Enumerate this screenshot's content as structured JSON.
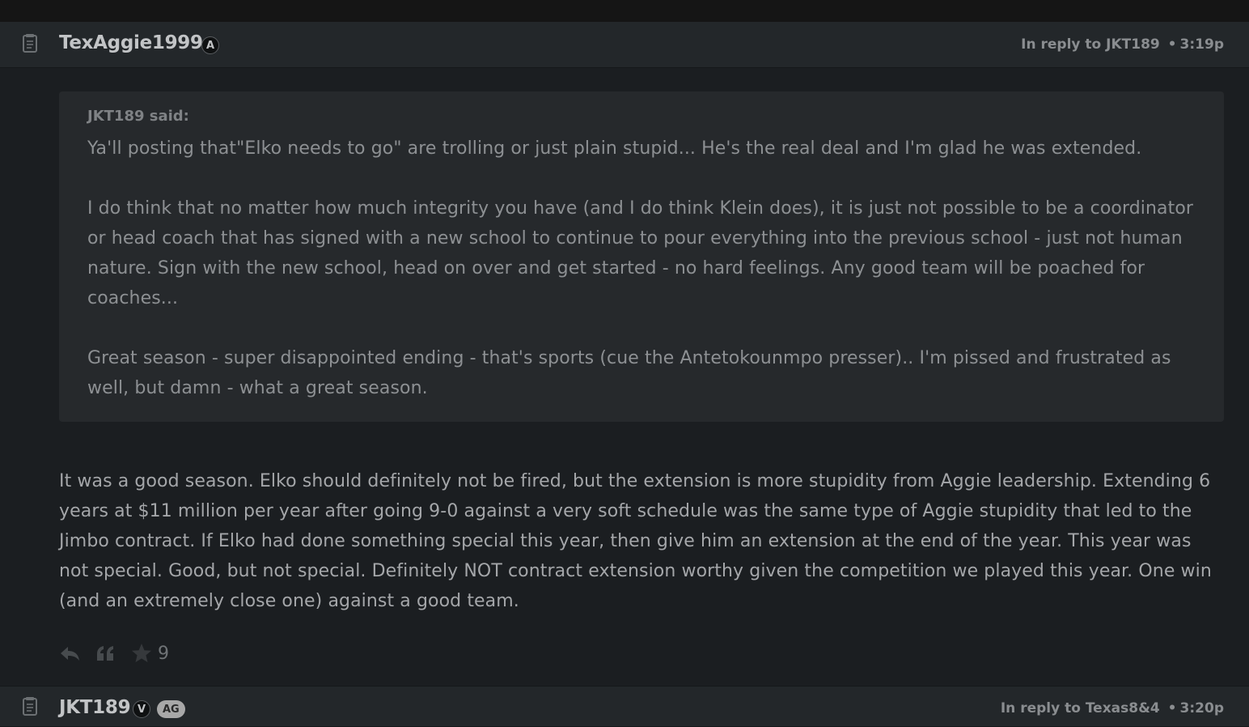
{
  "posts": [
    {
      "username": "TexAggie1999",
      "badges": [
        {
          "type": "circle",
          "label": "A"
        }
      ],
      "reply_to_label": "In reply to",
      "reply_to_user": "JKT189",
      "separator": "•",
      "time": "3:19p",
      "quote": {
        "author_line": "JKT189 said:",
        "paragraphs": [
          "Ya'll posting that\"Elko needs to go\" are trolling or just plain stupid... He's the real deal and I'm glad he was extended.",
          "I do think that no matter how much integrity you have (and I do think Klein does), it is just not possible to be a coordinator or head coach that has signed with a new school to continue to pour everything into the previous school - just not human nature. Sign with the new school, head on over and get started - no hard feelings. Any good team will be poached for coaches...",
          "Great season - super disappointed ending - that's sports (cue the Antetokounmpo presser).. I'm pissed and frustrated as well, but damn - what a great season."
        ]
      },
      "body": "It was a good season. Elko should definitely not be fired, but the extension is more stupidity from Aggie leadership. Extending 6 years at $11 million per year after going 9-0 against a very soft schedule was the same type of Aggie stupidity that led to the Jimbo contract. If Elko had done something special this year, then give him an extension at the end of the year. This year was not special. Good, but not special. Definitely NOT contract extension worthy given the competition we played this year. One win (and an extremely close one) against a good team.",
      "actions": {
        "reply_icon": "reply-arrow-icon",
        "quote_icon": "quote-icon",
        "star_icon": "star-icon",
        "star_count": "9"
      }
    },
    {
      "username": "JKT189",
      "badges": [
        {
          "type": "circle",
          "label": "V"
        },
        {
          "type": "pill",
          "label": "AG"
        }
      ],
      "reply_to_label": "In reply to",
      "reply_to_user": "Texas8&4",
      "separator": "•",
      "time": "3:20p"
    }
  ],
  "icons": {
    "post_icon": "document-list-icon"
  },
  "colors": {
    "page_bg": "#1b1e21",
    "header_bg": "#23272a",
    "quote_bg": "#26292c",
    "text": "#a4a6a9",
    "muted": "#8a8d90"
  }
}
